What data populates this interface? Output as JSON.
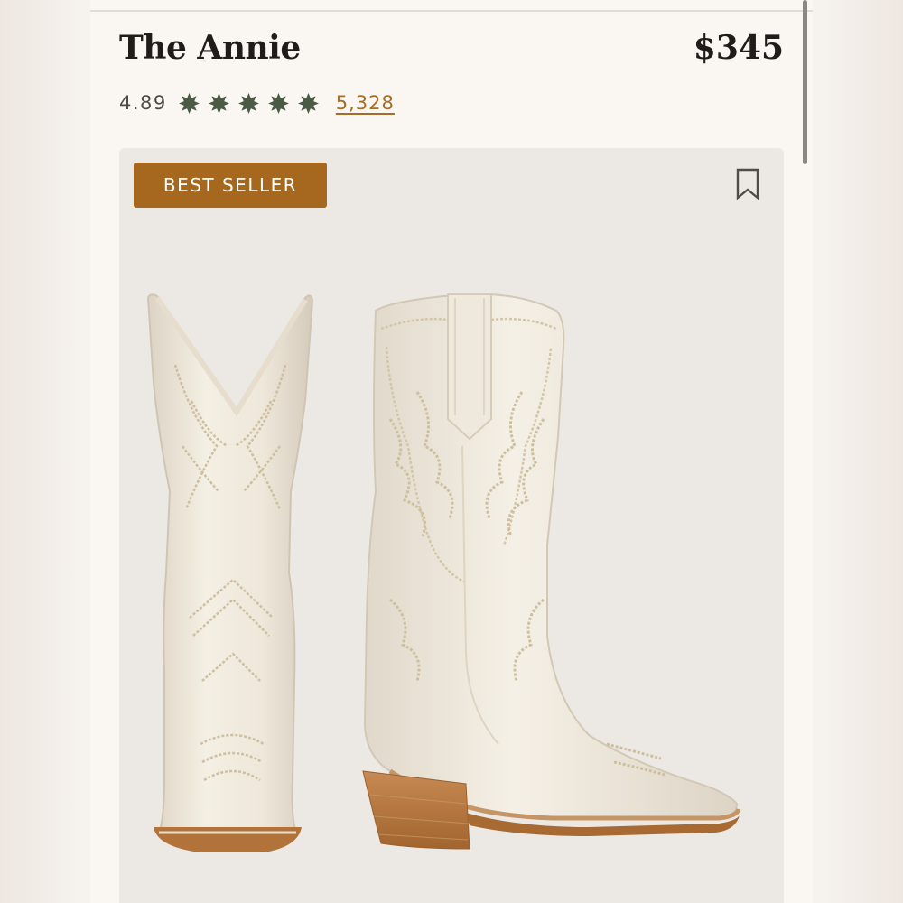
{
  "product": {
    "title": "The Annie",
    "price": "$345",
    "rating": "4.89",
    "stars": 5,
    "review_count": "5,328"
  },
  "card": {
    "badge": "BEST SELLER",
    "bookmark_icon": "bookmark-icon",
    "image": "white-cowboy-boots-photo"
  },
  "colors": {
    "accent": "#a5681e",
    "star": "#4a5a45",
    "link": "#a66d25",
    "card_bg": "#ece8e3",
    "page_bg": "#faf7f3"
  }
}
